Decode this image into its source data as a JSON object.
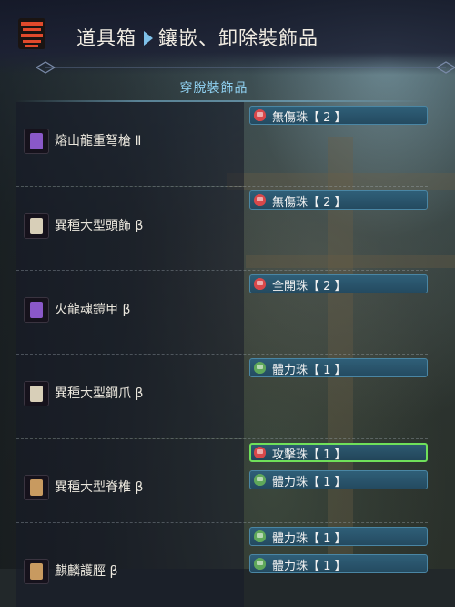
{
  "header": {
    "section": "道具箱",
    "title": "鑲嵌、卸除裝飾品"
  },
  "panel": {
    "title": "穿脫裝飾品"
  },
  "colors": {
    "accent": "#7ec0e8",
    "selected_border": "#6fe05a",
    "slot_bg": "#2f5f78"
  },
  "equipment": [
    {
      "name": "熔山龍重弩槍 Ⅱ",
      "icon": "heavy-bowgun-icon",
      "decorations": [
        {
          "label": "無傷珠【 2 】",
          "icon": "red-jewel-icon"
        }
      ]
    },
    {
      "name": "異種大型頭飾 β",
      "icon": "helm-icon",
      "decorations": [
        {
          "label": "無傷珠【 2 】",
          "icon": "red-jewel-icon"
        }
      ]
    },
    {
      "name": "火龍魂鎧甲 β",
      "icon": "chest-armor-icon",
      "decorations": [
        {
          "label": "全開珠【 2 】",
          "icon": "red-jewel-icon"
        }
      ]
    },
    {
      "name": "異種大型鋼爪 β",
      "icon": "gauntlet-icon",
      "decorations": [
        {
          "label": "體力珠【 1 】",
          "icon": "green-jewel-icon"
        }
      ]
    },
    {
      "name": "異種大型脊椎 β",
      "icon": "waist-armor-icon",
      "decorations": [
        {
          "label": "攻擊珠【 1 】",
          "icon": "red-jewel-icon",
          "selected": true
        },
        {
          "label": "體力珠【 1 】",
          "icon": "green-jewel-icon"
        }
      ]
    },
    {
      "name": "麒麟護脛 β",
      "icon": "greaves-icon",
      "decorations": [
        {
          "label": "體力珠【 1 】",
          "icon": "green-jewel-icon"
        },
        {
          "label": "體力珠【 1 】",
          "icon": "green-jewel-icon"
        }
      ]
    }
  ]
}
